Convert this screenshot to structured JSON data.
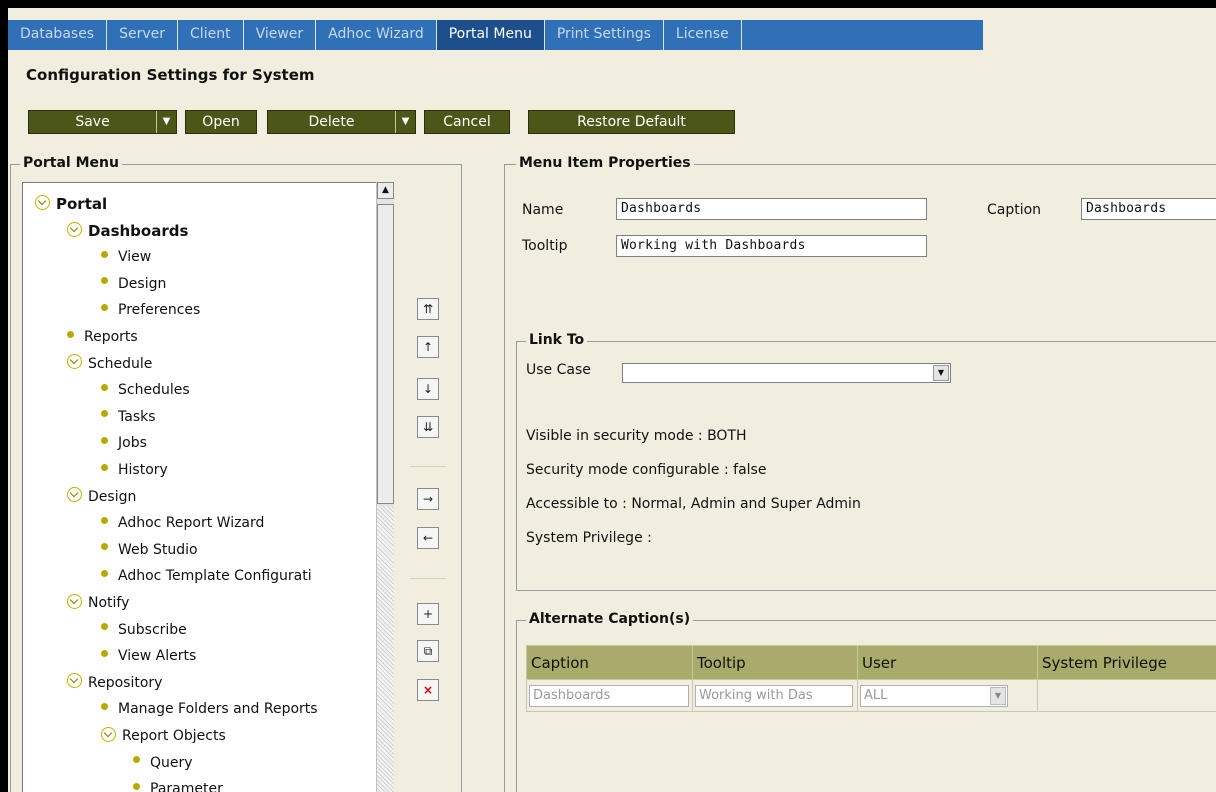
{
  "tabs": [
    "Databases",
    "Server",
    "Client",
    "Viewer",
    "Adhoc Wizard",
    "Portal Menu",
    "Print Settings",
    "License"
  ],
  "active_tab": "Portal Menu",
  "page_title": "Configuration Settings for System",
  "toolbar": {
    "save": "Save",
    "open": "Open",
    "delete": "Delete",
    "cancel": "Cancel",
    "restore": "Restore Default"
  },
  "portal_menu": {
    "legend": "Portal Menu",
    "tree": [
      {
        "label": "Portal",
        "level": 0,
        "type": "folder",
        "bold": true
      },
      {
        "label": "Dashboards",
        "level": 1,
        "type": "folder",
        "bold": true
      },
      {
        "label": "View",
        "level": 2,
        "type": "leaf"
      },
      {
        "label": "Design",
        "level": 2,
        "type": "leaf"
      },
      {
        "label": "Preferences",
        "level": 2,
        "type": "leaf"
      },
      {
        "label": "Reports",
        "level": 1,
        "type": "leaf"
      },
      {
        "label": "Schedule",
        "level": 1,
        "type": "folder"
      },
      {
        "label": "Schedules",
        "level": 2,
        "type": "leaf"
      },
      {
        "label": "Tasks",
        "level": 2,
        "type": "leaf"
      },
      {
        "label": "Jobs",
        "level": 2,
        "type": "leaf"
      },
      {
        "label": "History",
        "level": 2,
        "type": "leaf"
      },
      {
        "label": "Design",
        "level": 1,
        "type": "folder"
      },
      {
        "label": "Adhoc Report Wizard",
        "level": 2,
        "type": "leaf"
      },
      {
        "label": "Web Studio",
        "level": 2,
        "type": "leaf"
      },
      {
        "label": "Adhoc Template Configurati",
        "level": 2,
        "type": "leaf"
      },
      {
        "label": "Notify",
        "level": 1,
        "type": "folder"
      },
      {
        "label": "Subscribe",
        "level": 2,
        "type": "leaf"
      },
      {
        "label": "View Alerts",
        "level": 2,
        "type": "leaf"
      },
      {
        "label": "Repository",
        "level": 1,
        "type": "folder"
      },
      {
        "label": "Manage Folders and Reports",
        "level": 2,
        "type": "leaf"
      },
      {
        "label": "Report Objects",
        "level": 2,
        "type": "folder"
      },
      {
        "label": "Query",
        "level": 3,
        "type": "leaf"
      },
      {
        "label": "Parameter",
        "level": 3,
        "type": "leaf"
      }
    ],
    "move_buttons": [
      "move-top-icon",
      "move-up-icon",
      "move-down-icon",
      "move-bottom-icon",
      "indent-icon",
      "outdent-icon",
      "add-icon",
      "copy-icon",
      "delete-icon"
    ]
  },
  "menu_item_properties": {
    "legend": "Menu Item Properties",
    "name_label": "Name",
    "name_value": "Dashboards",
    "caption_label": "Caption",
    "caption_value": "Dashboards",
    "tooltip_label": "Tooltip",
    "tooltip_value": "Working with Dashboards"
  },
  "link_to": {
    "legend": "Link To",
    "use_case_label": "Use Case",
    "use_case_value": "",
    "visible_mode": "Visible in security mode : BOTH",
    "configurable": "Security mode configurable : false",
    "accessible": "Accessible to : Normal, Admin and Super Admin",
    "privilege": "System Privilege :"
  },
  "alternate_captions": {
    "legend": "Alternate Caption(s)",
    "columns": [
      "Caption",
      "Tooltip",
      "User",
      "System Privilege"
    ],
    "rows": [
      {
        "caption": "Dashboards",
        "tooltip": "Working with Das",
        "user": "ALL",
        "privilege": ""
      }
    ]
  }
}
